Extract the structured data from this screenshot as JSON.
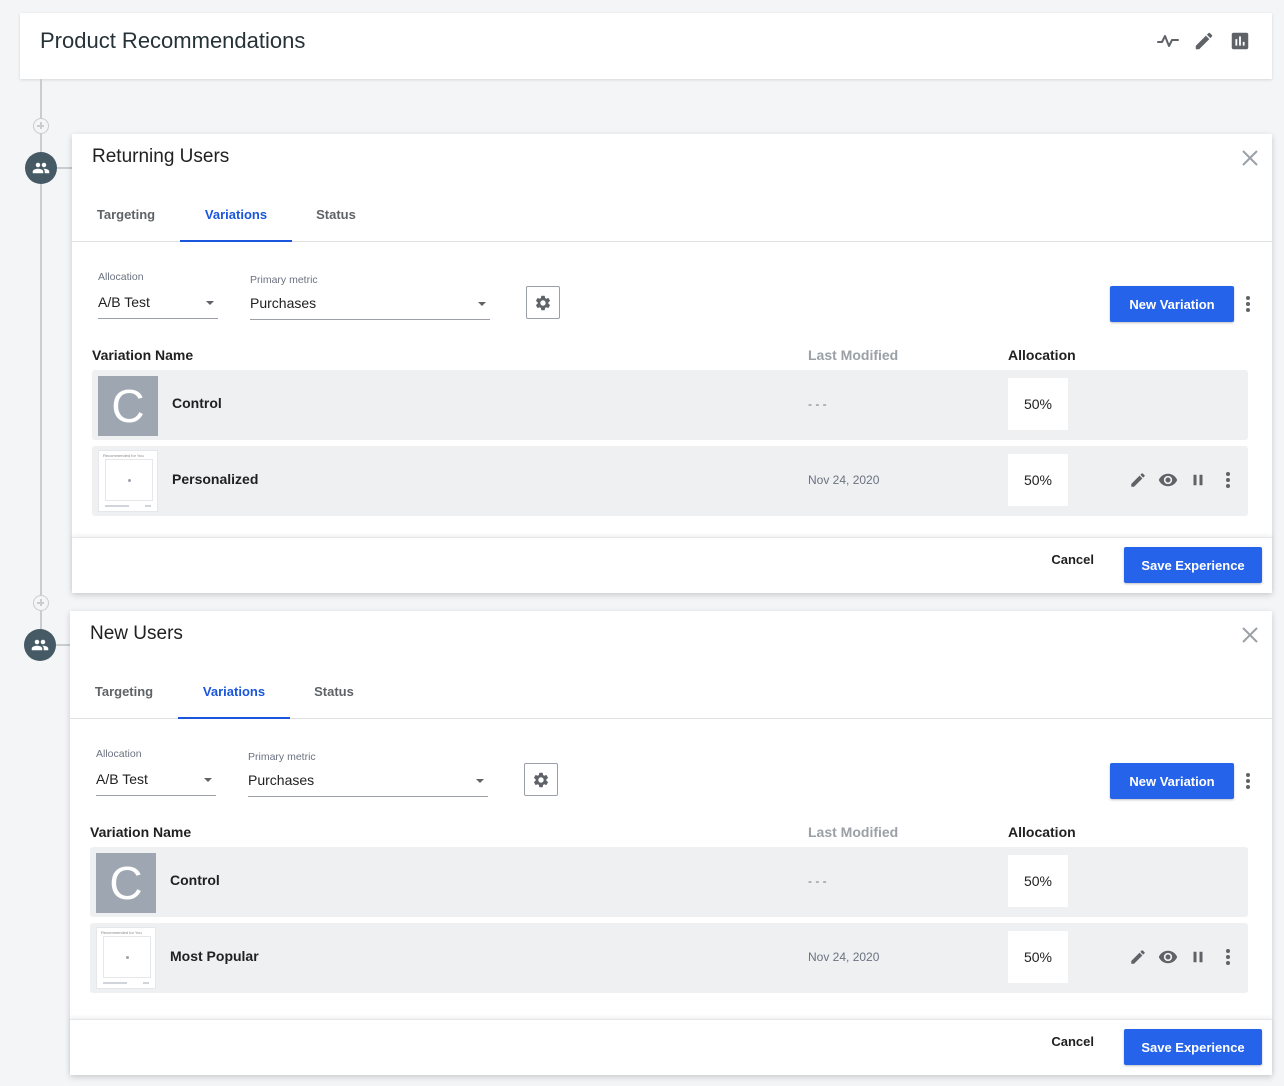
{
  "header": {
    "title": "Product Recommendations",
    "icons": [
      "activity-icon",
      "edit-icon",
      "chart-icon"
    ]
  },
  "colors": {
    "accent": "#2563eb",
    "node": "#455a64",
    "rowBg": "#eef0f2"
  },
  "cards": [
    {
      "title": "Returning Users",
      "tabs": [
        {
          "label": "Targeting",
          "active": false
        },
        {
          "label": "Variations",
          "active": true
        },
        {
          "label": "Status",
          "active": false
        }
      ],
      "allocation": {
        "label": "Allocation",
        "value": "A/B Test"
      },
      "metric": {
        "label": "Primary metric",
        "value": "Purchases"
      },
      "new_variation_label": "New Variation",
      "table_headers": {
        "name": "Variation Name",
        "modified": "Last Modified",
        "allocation": "Allocation"
      },
      "rows": [
        {
          "thumb": "C",
          "name": "Control",
          "modified": "- - -",
          "allocation": "50%",
          "actions": false
        },
        {
          "thumb_text": "Recommended for You",
          "name": "Personalized",
          "modified": "Nov 24, 2020",
          "allocation": "50%",
          "actions": true
        }
      ],
      "footer": {
        "cancel": "Cancel",
        "save": "Save Experience"
      }
    },
    {
      "title": "New Users",
      "tabs": [
        {
          "label": "Targeting",
          "active": false
        },
        {
          "label": "Variations",
          "active": true
        },
        {
          "label": "Status",
          "active": false
        }
      ],
      "allocation": {
        "label": "Allocation",
        "value": "A/B Test"
      },
      "metric": {
        "label": "Primary metric",
        "value": "Purchases"
      },
      "new_variation_label": "New Variation",
      "table_headers": {
        "name": "Variation Name",
        "modified": "Last Modified",
        "allocation": "Allocation"
      },
      "rows": [
        {
          "thumb": "C",
          "name": "Control",
          "modified": "- - -",
          "allocation": "50%",
          "actions": false
        },
        {
          "thumb_text": "Recommended for You",
          "name": "Most Popular",
          "modified": "Nov 24, 2020",
          "allocation": "50%",
          "actions": true
        }
      ],
      "footer": {
        "cancel": "Cancel",
        "save": "Save Experience"
      }
    }
  ]
}
